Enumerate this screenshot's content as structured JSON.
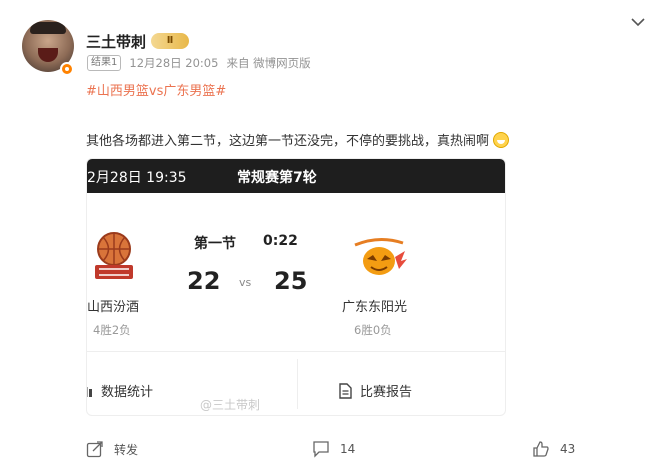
{
  "user": {
    "name": "三土带刺",
    "vip_label": "Ⅱ"
  },
  "meta": {
    "tag": "结果1",
    "time": "12月28日 20:05",
    "source": "来自 微博网页版"
  },
  "post": {
    "topic": "#山西男篮vs广东男篮#",
    "text": "其他各场都进入第二节，这边第一节还没完，不停的要挑战，真热闹啊"
  },
  "game": {
    "datetime": "2月28日 19:35",
    "round": "常规赛第7轮",
    "period": "第一节",
    "clock": "0:22",
    "vs": "vs",
    "home": {
      "name": "山西汾酒",
      "score": "22",
      "record": "4胜2负",
      "logo_color": "#c0392b"
    },
    "away": {
      "name": "广东东阳光",
      "score": "25",
      "record": "6胜0负",
      "logo_color": "#f39c12"
    },
    "stats_label": "数据统计",
    "report_label": "比赛报告"
  },
  "watermark": "@三土带刺",
  "actions": {
    "repost_label": "转发",
    "comment_count": "14",
    "like_count": "43"
  },
  "colors": {
    "accent": "#eb7350",
    "header_bg": "#1e1e1e"
  }
}
